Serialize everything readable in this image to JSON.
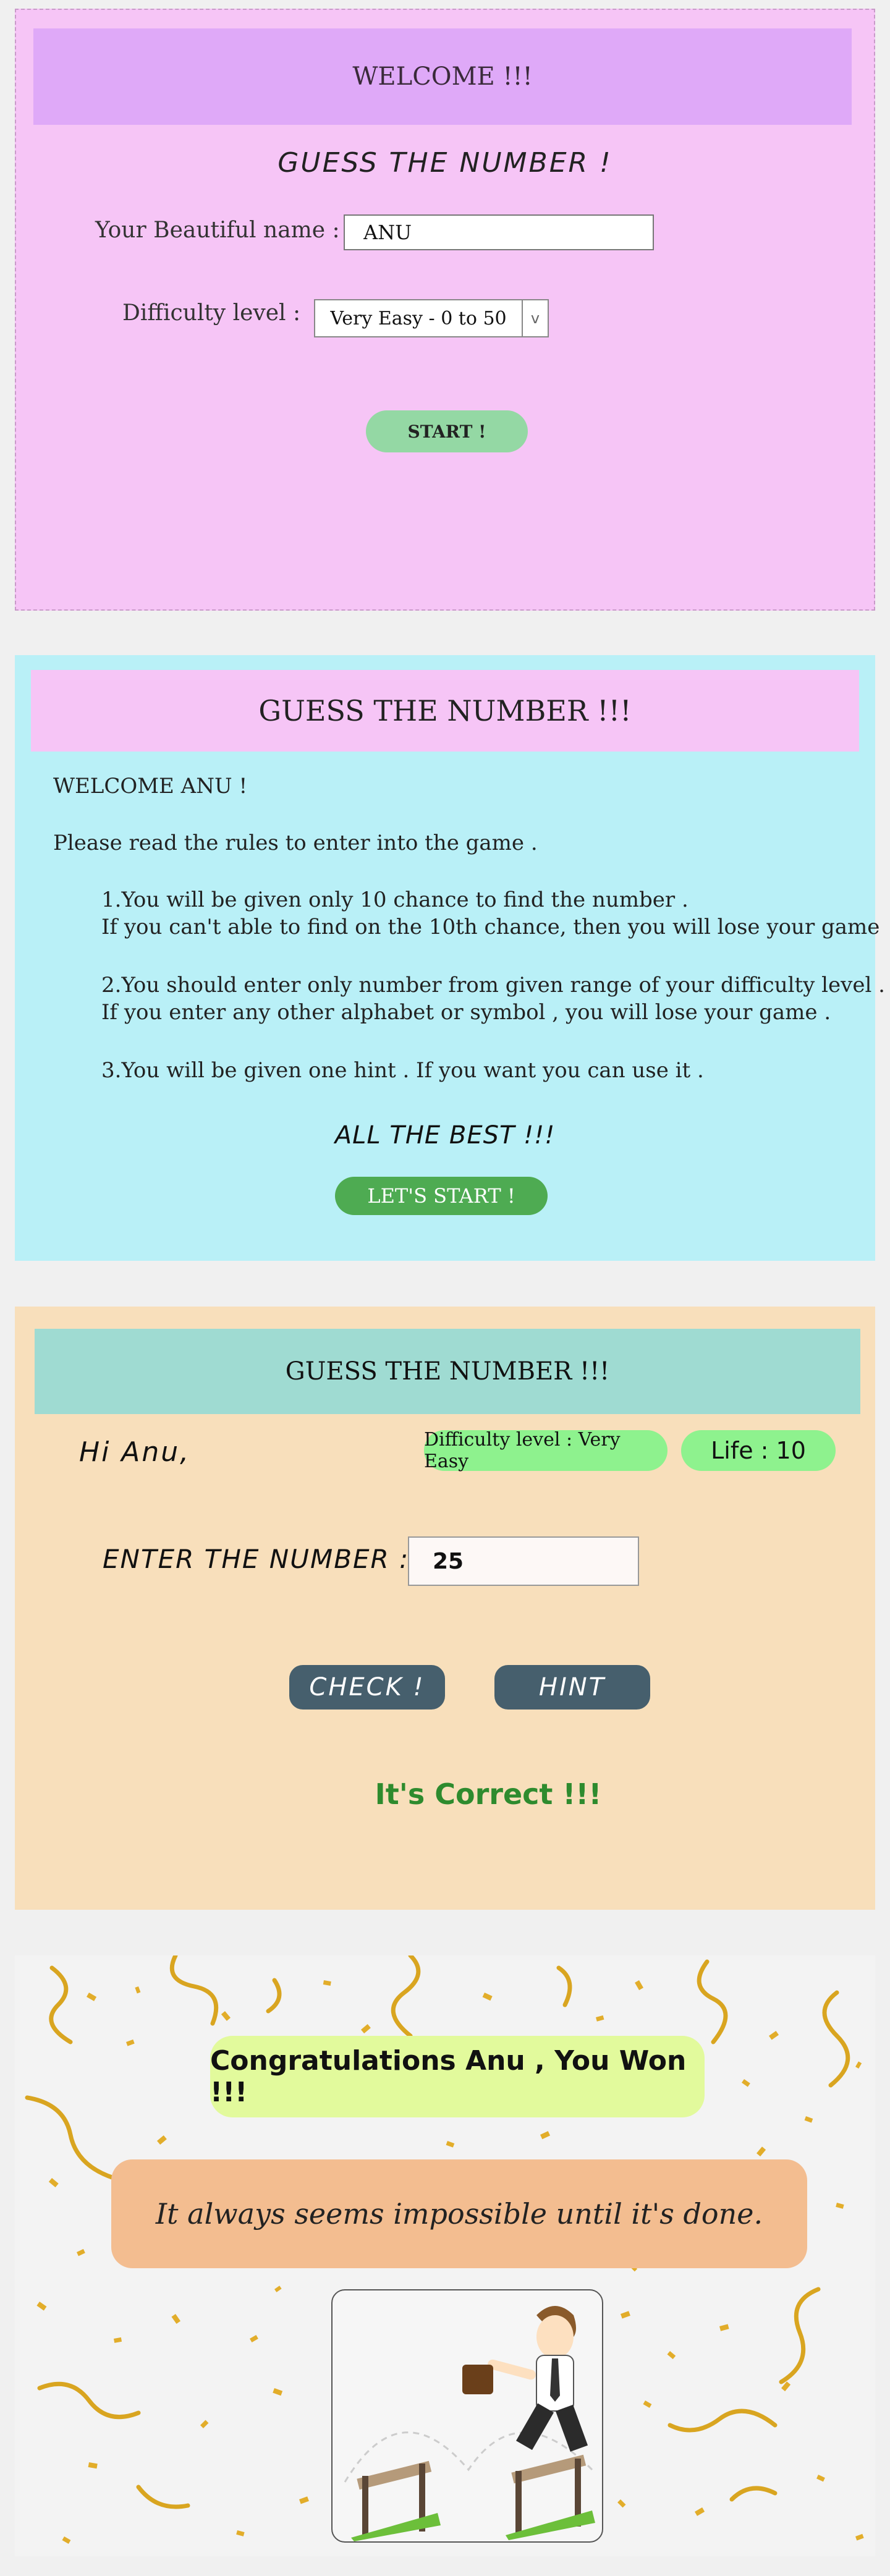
{
  "welcome_screen": {
    "banner": "WELCOME !!!",
    "subtitle": "GUESS THE NUMBER !",
    "name_label": "Your Beautiful name :",
    "name_value": "ANU",
    "difficulty_label": "Difficulty level :",
    "difficulty_selected": "Very Easy - 0 to 50",
    "start_button": "START !"
  },
  "rules_screen": {
    "banner": "GUESS THE NUMBER !!!",
    "greeting": "WELCOME ANU !",
    "intro": "Please read the rules to enter into the game .",
    "rules": [
      "1.You will be given only 10 chance to find the number .",
      "If you  can't able to  find on the 10th chance, then you will lose your game",
      "2.You should enter only number from given range of your difficulty level .",
      "If you enter any other alphabet or symbol , you will lose your game .",
      "3.You will be given one hint . If you want you can use it ."
    ],
    "all_the_best": "ALL THE BEST !!!",
    "lets_start_button": "LET'S START !"
  },
  "game_screen": {
    "banner": "GUESS THE NUMBER !!!",
    "greeting": "Hi  Anu,",
    "difficulty_badge": "Difficulty level : Very Easy",
    "life_badge": "Life : 10",
    "enter_label": "ENTER THE NUMBER :",
    "number_value": "25",
    "check_button": "CHECK !",
    "hint_button": "HINT",
    "result": "It's Correct !!!"
  },
  "win_screen": {
    "congrats": "Congratulations Anu , You Won !!!",
    "quote": "It always seems impossible until it's done."
  },
  "colors": {
    "welcome_bg": "#f6c5f6",
    "rules_bg": "#b9f0f7",
    "game_bg": "#f8dfbb",
    "result_green": "#2e8b2e",
    "button_slate": "#465f6d"
  }
}
